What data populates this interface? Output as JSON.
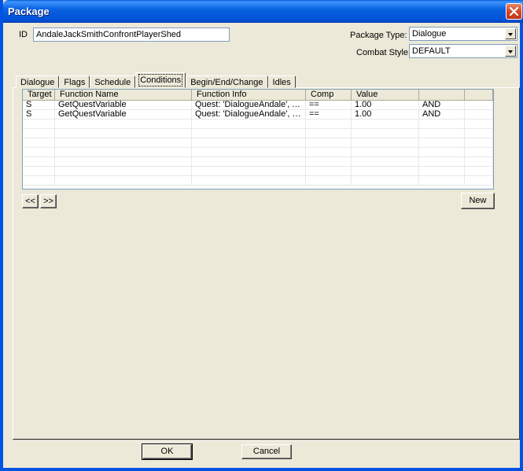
{
  "window": {
    "title": "Package"
  },
  "form": {
    "id_label": "ID",
    "id_value": "AndaleJackSmithConfrontPlayerShed",
    "package_type_label": "Package Type:",
    "package_type_value": "Dialogue",
    "combat_style_label": "Combat Style:",
    "combat_style_value": "DEFAULT"
  },
  "tabs": [
    {
      "label": "Dialogue"
    },
    {
      "label": "Flags"
    },
    {
      "label": "Schedule"
    },
    {
      "label": "Conditions"
    },
    {
      "label": "Begin/End/Change"
    },
    {
      "label": "Idles"
    }
  ],
  "conditions": {
    "columns": [
      "Target",
      "Function Name",
      "Function Info",
      "Comp",
      "Value",
      "",
      ""
    ],
    "rows": [
      [
        "S",
        "GetQuestVariable",
        "Quest: 'DialogueAndale', Andal...",
        "==",
        "1.00",
        "AND",
        ""
      ],
      [
        "S",
        "GetQuestVariable",
        "Quest: 'DialogueAndale', Playe...",
        "==",
        "1.00",
        "AND",
        ""
      ]
    ],
    "prev_label": "<<",
    "next_label": ">>",
    "new_label": "New"
  },
  "footer": {
    "ok_label": "OK",
    "cancel_label": "Cancel"
  }
}
